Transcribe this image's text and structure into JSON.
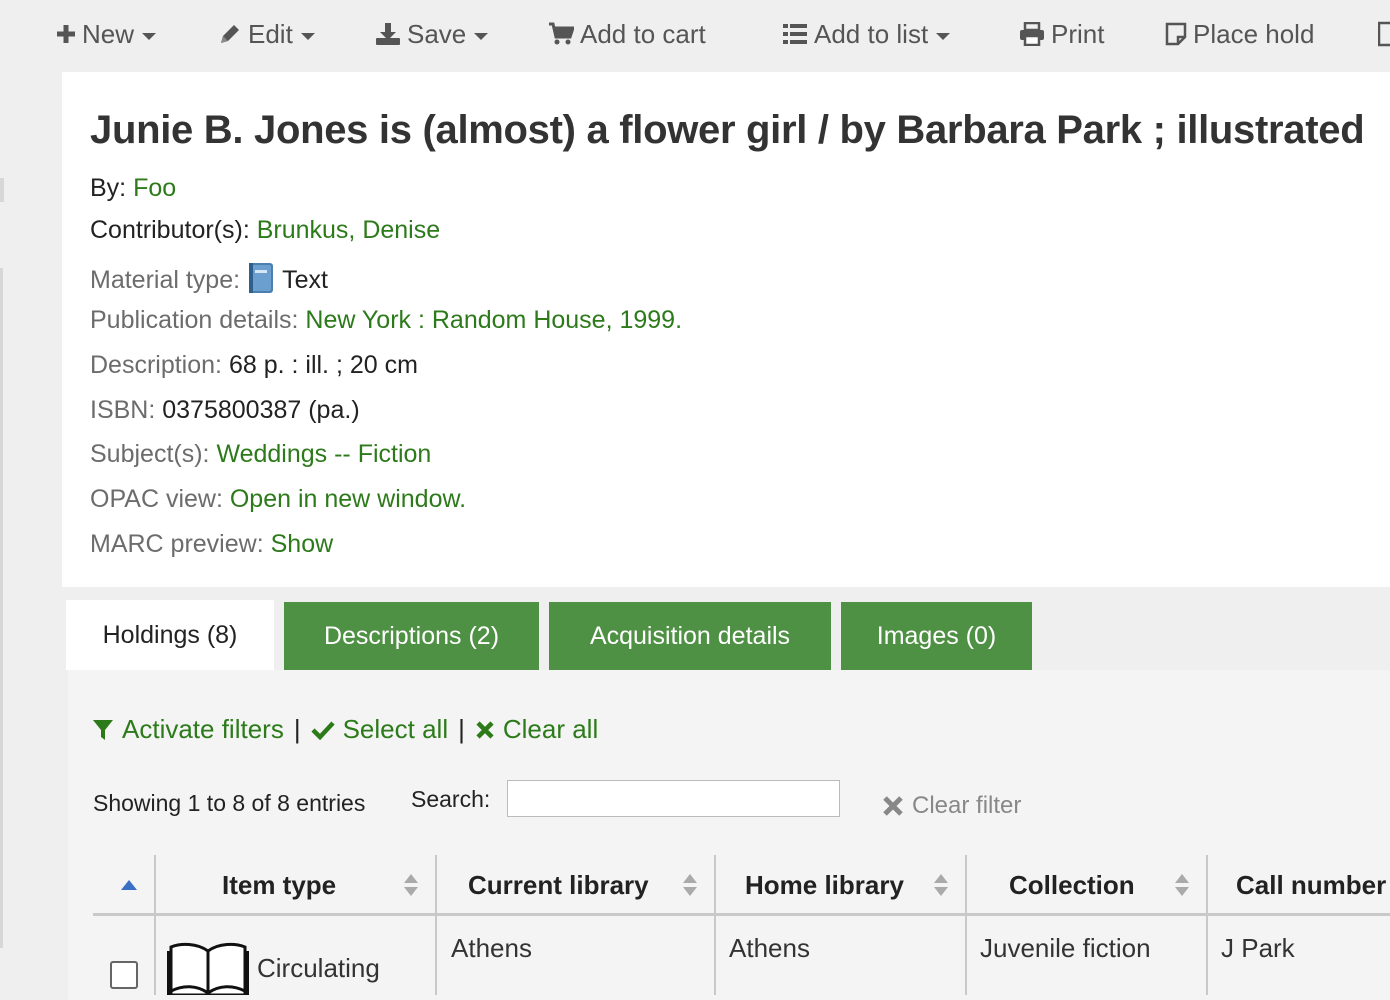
{
  "toolbar": {
    "new_label": "New",
    "edit_label": "Edit",
    "save_label": "Save",
    "add_to_cart_label": "Add to cart",
    "add_to_list_label": "Add to list",
    "print_label": "Print",
    "place_hold_label": "Place hold"
  },
  "record": {
    "title": "Junie B. Jones is (almost) a flower girl / by Barbara Park ; illustrated",
    "by_label": "By:",
    "by_value": "Foo",
    "contributors_label": "Contributor(s):",
    "contributors_value": "Brunkus, Denise",
    "material_type_label": "Material type:",
    "material_type_value": "Text",
    "publication_label": "Publication details:",
    "publication_value": "New York : Random House, 1999.",
    "description_label": "Description:",
    "description_value": "68 p. : ill. ; 20 cm",
    "isbn_label": "ISBN:",
    "isbn_value": "0375800387 (pa.)",
    "subjects_label": "Subject(s):",
    "subjects_value": "Weddings -- Fiction",
    "opac_label": "OPAC view:",
    "opac_value": "Open in new window.",
    "marc_label": "MARC preview:",
    "marc_value": "Show"
  },
  "tabs": [
    {
      "label": "Holdings (8)"
    },
    {
      "label": "Descriptions (2)"
    },
    {
      "label": "Acquisition details"
    },
    {
      "label": "Images (0)"
    }
  ],
  "filters": {
    "activate": "Activate filters",
    "select_all": "Select all",
    "clear_all": "Clear all",
    "separator": "|"
  },
  "list_info": {
    "showing": "Showing 1 to 8 of 8 entries",
    "search_label": "Search:",
    "search_value": "",
    "clear_filter": "Clear filter"
  },
  "table": {
    "columns": [
      "Item type",
      "Current library",
      "Home library",
      "Collection",
      "Call number"
    ],
    "rows": [
      {
        "item_type": "Circulating",
        "current_library": "Athens",
        "home_library": "Athens",
        "collection": "Juvenile fiction",
        "call_number": "J Park"
      }
    ]
  },
  "colors": {
    "link_green": "#2d7a1b",
    "tab_green": "#4f9144",
    "sort_blue": "#3a6fc4"
  }
}
